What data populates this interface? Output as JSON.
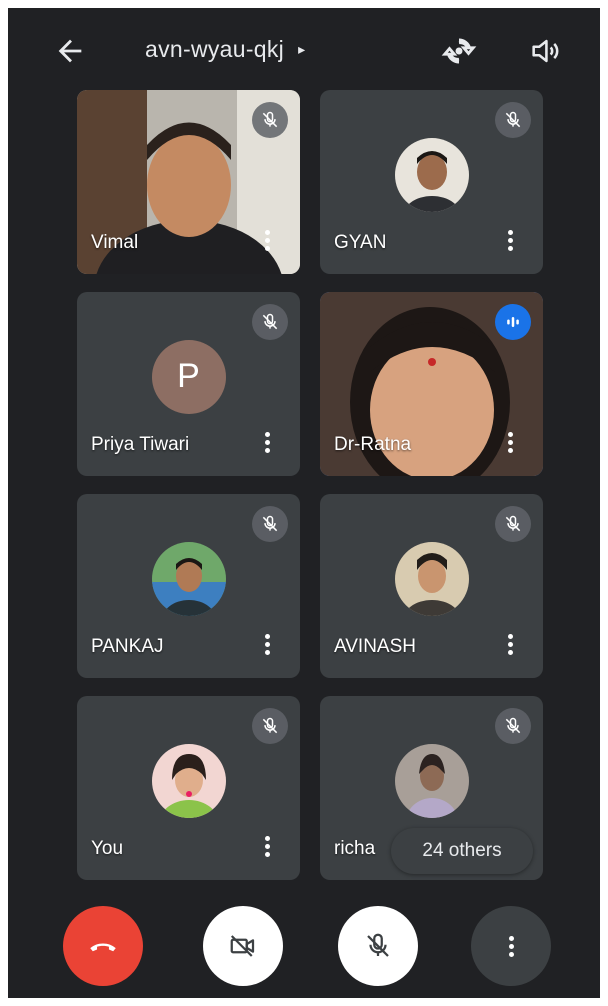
{
  "header": {
    "meeting_code": "avn-wyau-qkj",
    "caret": "▸"
  },
  "tiles": [
    {
      "name": "Vimal",
      "state": "muted",
      "media": "video"
    },
    {
      "name": "GYAN",
      "state": "muted",
      "media": "photo-avatar"
    },
    {
      "name": "Priya Tiwari",
      "state": "muted",
      "media": "letter-avatar",
      "avatar_letter": "P"
    },
    {
      "name": "Dr-Ratna",
      "state": "speaking",
      "media": "video"
    },
    {
      "name": "PANKAJ",
      "state": "muted",
      "media": "photo-avatar"
    },
    {
      "name": "AVINASH",
      "state": "muted",
      "media": "photo-avatar"
    },
    {
      "name": "You",
      "state": "muted",
      "media": "photo-avatar"
    },
    {
      "name": "richa",
      "state": "muted",
      "media": "photo-avatar"
    }
  ],
  "others_label": "24 others",
  "controls": {
    "end_call": "phone-hangup-icon",
    "camera": "camera-off-icon",
    "mic": "mic-off-icon",
    "more": "more-vert-icon"
  },
  "colors": {
    "background": "#202124",
    "tile": "#3c4043",
    "accent": "#1a73e8",
    "end_call": "#ea4335"
  }
}
